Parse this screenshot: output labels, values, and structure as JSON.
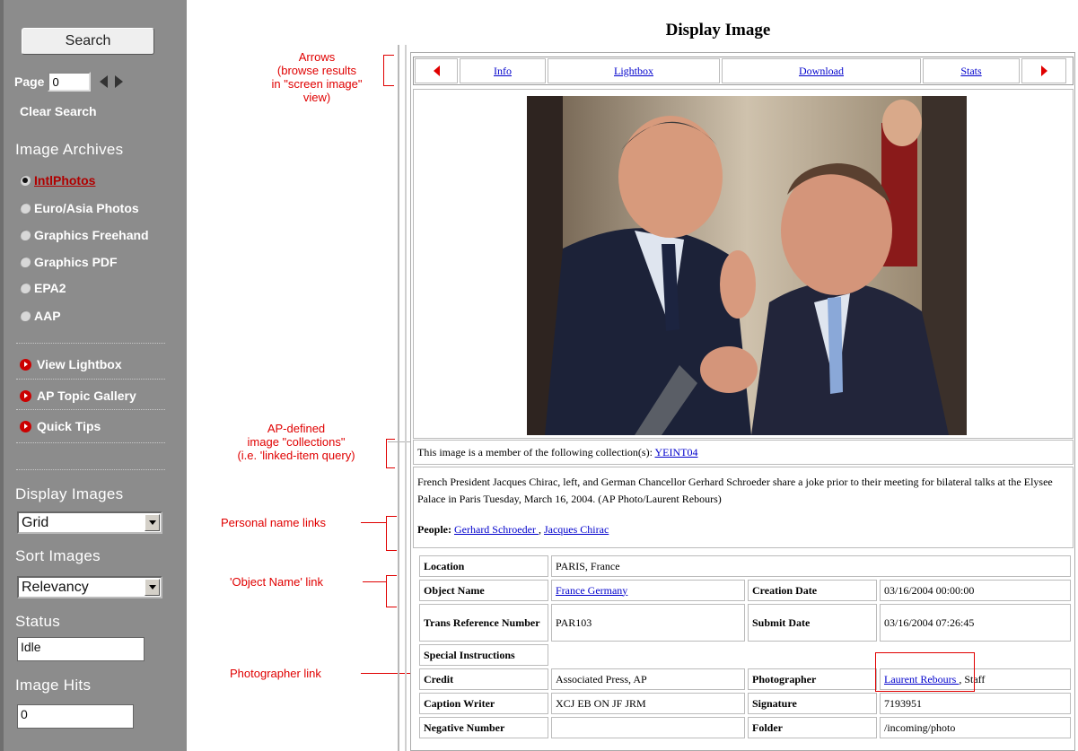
{
  "sidebar": {
    "search_label": "Search",
    "page_label": "Page",
    "page_value": "0",
    "clear_search": "Clear Search",
    "archives_title": "Image Archives",
    "archives": [
      {
        "label": "IntlPhotos",
        "selected": true
      },
      {
        "label": "Euro/Asia Photos",
        "selected": false
      },
      {
        "label": "Graphics Freehand",
        "selected": false
      },
      {
        "label": "Graphics PDF",
        "selected": false
      },
      {
        "label": "EPA2",
        "selected": false
      },
      {
        "label": "AAP",
        "selected": false
      }
    ],
    "links": [
      "View Lightbox",
      "AP Topic Gallery",
      "Quick Tips"
    ],
    "display_title": "Display Images",
    "display_value": "Grid",
    "sort_title": "Sort Images",
    "sort_value": "Relevancy",
    "status_title": "Status",
    "status_value": "Idle",
    "hits_title": "Image Hits",
    "hits_value": "0"
  },
  "annotations": {
    "arrows": "Arrows\n(browse results\nin \"screen image\"\nview)",
    "collections": "AP-defined\nimage \"collections\"\n(i.e. 'linked-item query)",
    "personal": "Personal name links",
    "object": "'Object Name' link",
    "photographer": "Photographer link"
  },
  "display": {
    "title": "Display Image",
    "toolbar": [
      "Info",
      "Lightbox",
      "Download",
      "Stats"
    ],
    "collection_text": "This image is a member of the following collection(s): ",
    "collection_link": "YEINT04",
    "caption": "French President Jacques Chirac, left, and German Chancellor Gerhard Schroeder share a joke prior to their meeting for bilateral talks at the Elysee Palace in Paris Tuesday, March 16, 2004. (AP Photo/Laurent Rebours)",
    "people_label": "People:",
    "people": [
      "Gerhard Schroeder ",
      "Jacques Chirac "
    ],
    "meta": {
      "location_k": "Location",
      "location_v": "PARIS, France",
      "object_k": "Object Name",
      "object_v": "France Germany",
      "creation_k": "Creation Date",
      "creation_v": "03/16/2004 00:00:00",
      "trans_k": "Trans Reference Number",
      "trans_v": "PAR103",
      "submit_k": "Submit Date",
      "submit_v": "03/16/2004 07:26:45",
      "special_k": "Special Instructions",
      "credit_k": "Credit",
      "credit_v": "Associated Press, AP",
      "photog_k": "Photographer",
      "photog_v": "Laurent Rebours ",
      "photog_suffix": ", Staff",
      "capwriter_k": "Caption Writer",
      "capwriter_v": "XCJ EB ON JF JRM",
      "signature_k": "Signature",
      "signature_v": "7193951",
      "negative_k": "Negative Number",
      "folder_k": "Folder",
      "folder_v": "/incoming/photo"
    }
  },
  "colors": {
    "annotation": "#e00000",
    "sidebar": "#8c8c8c",
    "link": "#0000cc"
  }
}
